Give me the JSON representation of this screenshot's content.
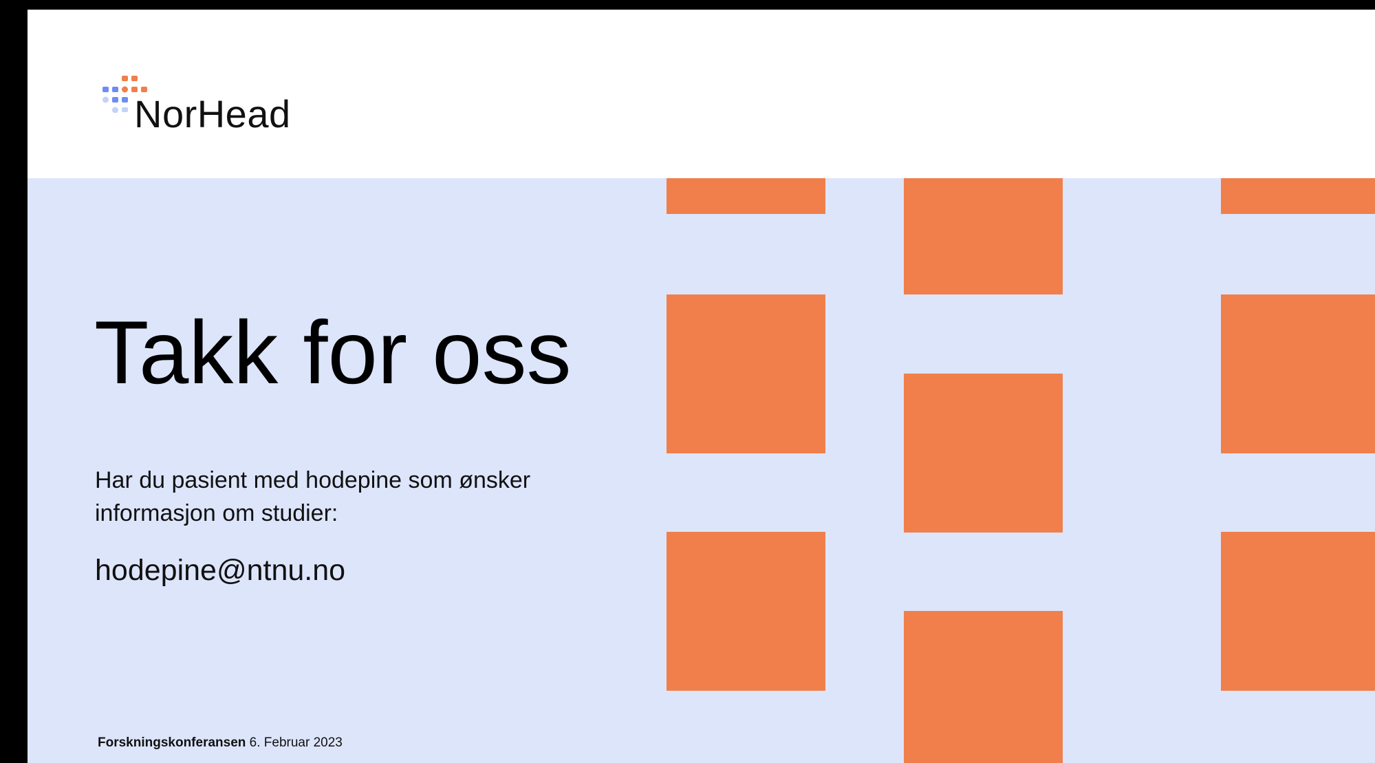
{
  "brand": {
    "logo_text": "NorHead",
    "logo_icon": "dot-grid-logo-icon",
    "colors": {
      "orange": "#f07f4b",
      "blue": "#6f8df0",
      "light_blue": "#c5d2f7"
    }
  },
  "slide": {
    "title": "Takk for oss",
    "body": "Har du pasient med hodepine som ønsker informasjon om studier:",
    "email": "hodepine@ntnu.no",
    "footer": {
      "event": "Forskningskonferansen",
      "date": "6. Februar 2023"
    }
  },
  "colors": {
    "background": "#dde5fb",
    "header": "#ffffff",
    "accent": "#f07f4b",
    "frame": "#000000"
  }
}
